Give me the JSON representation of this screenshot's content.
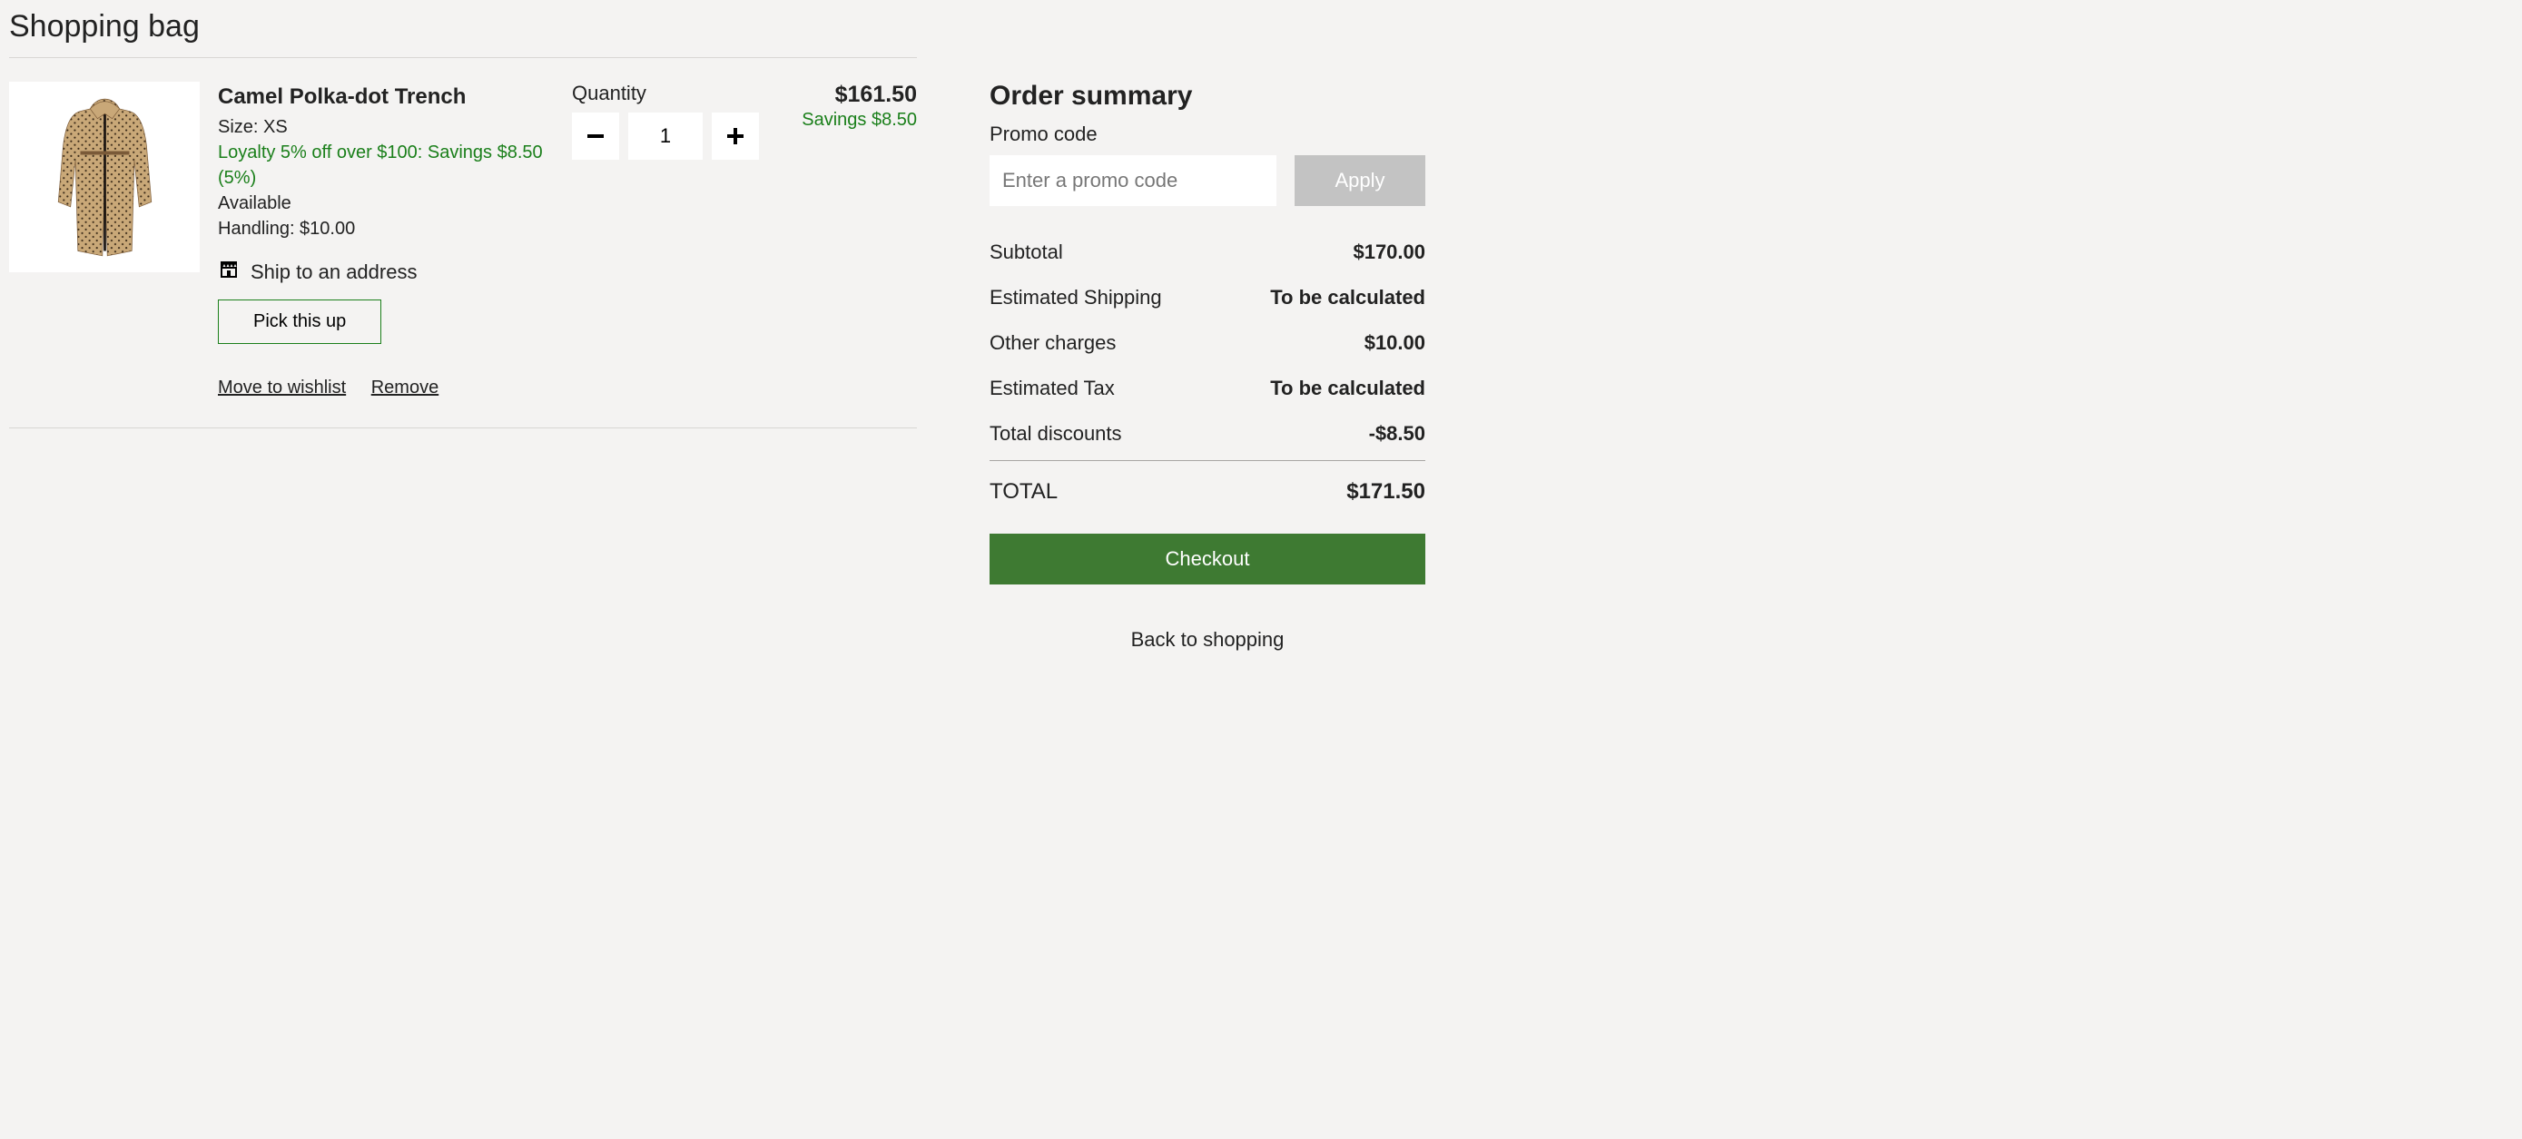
{
  "page_title": "Shopping bag",
  "item": {
    "name": "Camel Polka-dot Trench",
    "size_line": "Size: XS",
    "loyalty_line": "Loyalty 5% off over $100: Savings $8.50 (5%)",
    "availability": "Available",
    "handling_line": "Handling: $10.00",
    "ship_label": "Ship to an address",
    "pick_up_label": "Pick this up",
    "move_to_wishlist": "Move to wishlist",
    "remove": "Remove",
    "qty_label": "Quantity",
    "qty_value": "1",
    "price": "$161.50",
    "savings": "Savings $8.50"
  },
  "summary": {
    "title": "Order summary",
    "promo_label": "Promo code",
    "promo_placeholder": "Enter a promo code",
    "apply_label": "Apply",
    "lines": {
      "subtotal_label": "Subtotal",
      "subtotal_value": "$170.00",
      "shipping_label": "Estimated Shipping",
      "shipping_value": "To be calculated",
      "other_label": "Other charges",
      "other_value": "$10.00",
      "tax_label": "Estimated Tax",
      "tax_value": "To be calculated",
      "discounts_label": "Total discounts",
      "discounts_value": "-$8.50"
    },
    "total_label": "TOTAL",
    "total_value": "$171.50",
    "checkout_label": "Checkout",
    "back_label": "Back to shopping"
  }
}
